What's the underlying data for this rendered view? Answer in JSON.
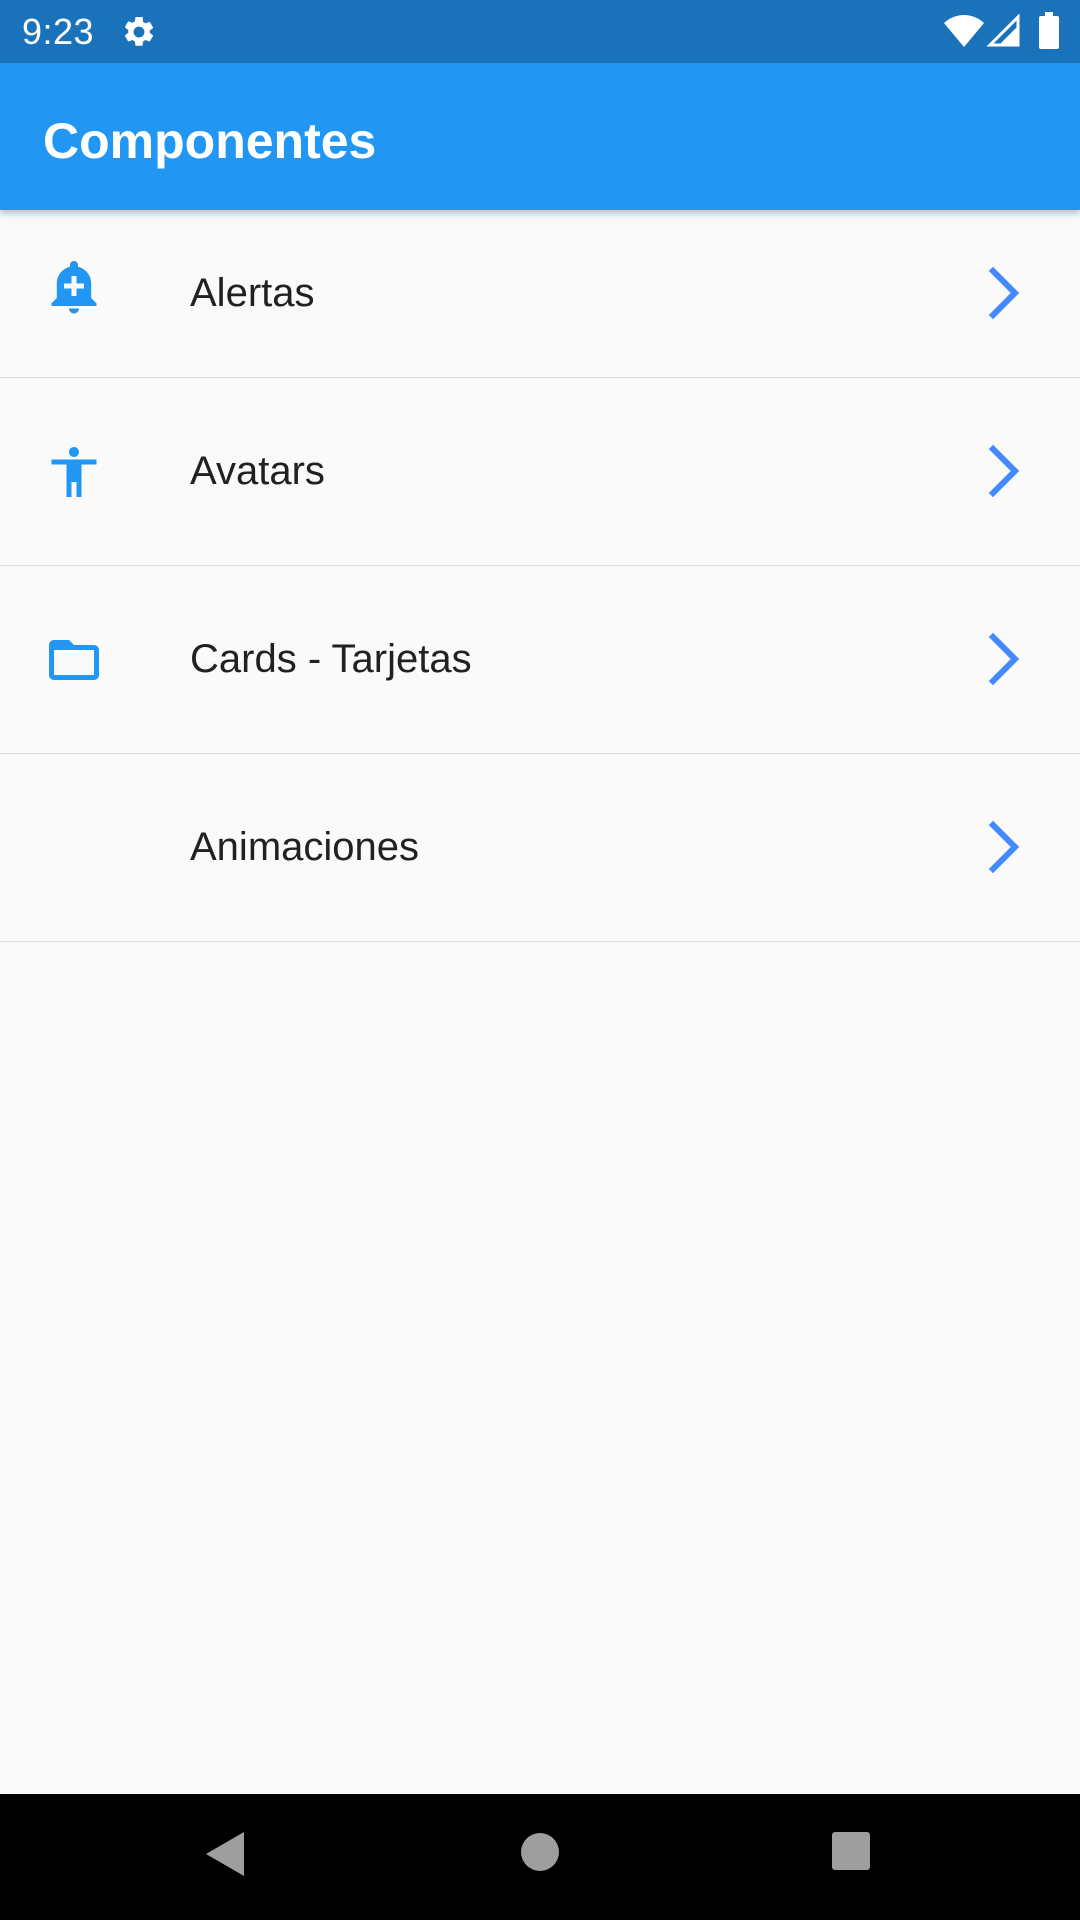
{
  "status_bar": {
    "time": "9:23",
    "icons": [
      "gear-icon",
      "wifi-icon",
      "signal-icon",
      "battery-icon"
    ]
  },
  "app_bar": {
    "title": "Componentes",
    "color": "#2196f3"
  },
  "list": {
    "items": [
      {
        "label": "Alertas",
        "icon": "add-alert-icon"
      },
      {
        "label": "Avatars",
        "icon": "accessibility-icon"
      },
      {
        "label": "Cards - Tarjetas",
        "icon": "folder-open-icon"
      },
      {
        "label": "Animaciones",
        "icon": ""
      }
    ],
    "trailing_icon": "chevron-right-icon",
    "icon_color": "#2196f3",
    "chevron_color": "#448aff"
  },
  "nav_bar": {
    "buttons": [
      "back-icon",
      "home-icon",
      "recents-icon"
    ]
  }
}
